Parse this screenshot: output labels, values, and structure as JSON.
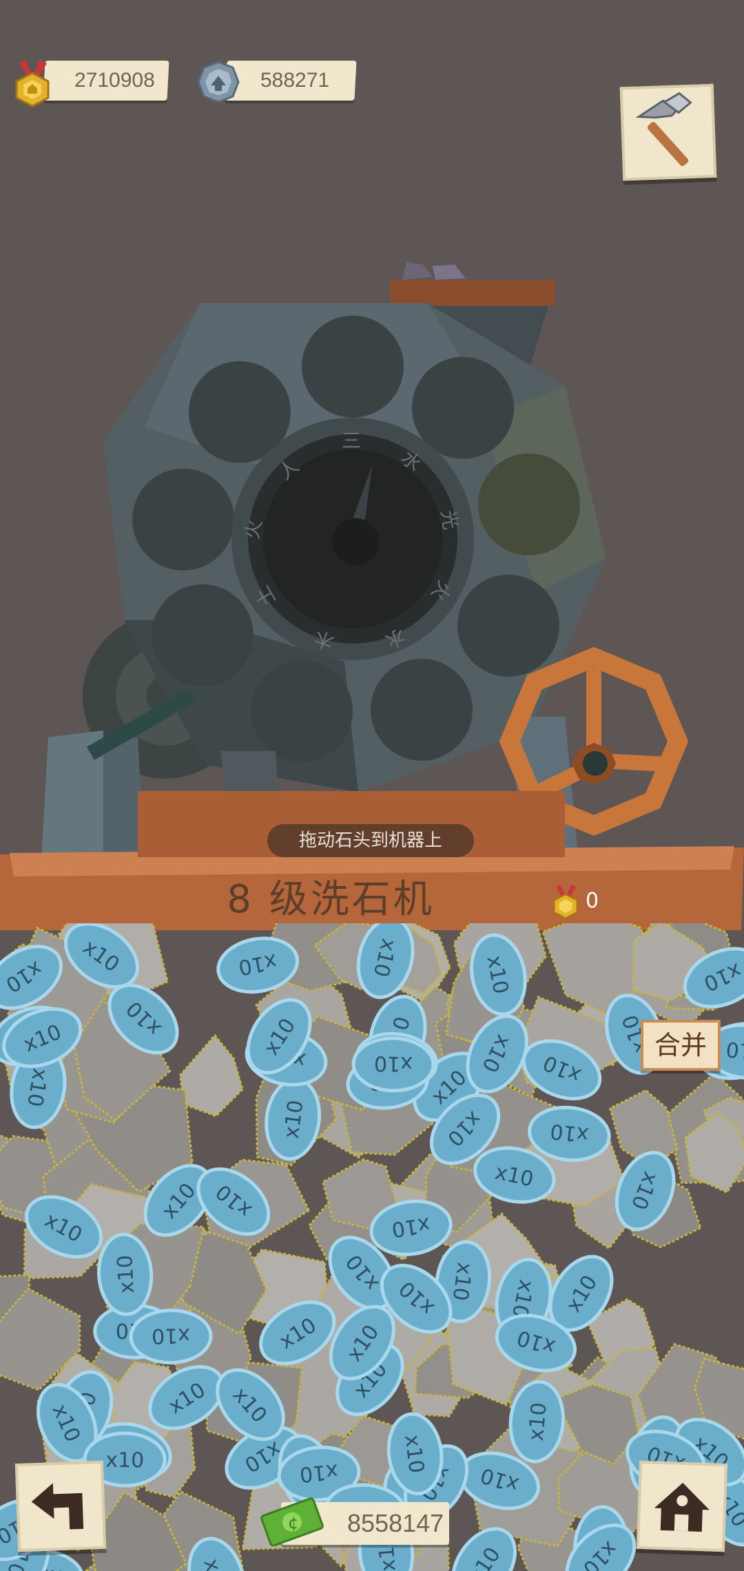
{
  "currencies": {
    "medals": "2710908",
    "stones": "588271",
    "cash": "8558147"
  },
  "machine": {
    "title": "8 级洗石机",
    "hint": "拖动石头到机器上",
    "reward_value": "0",
    "dial_symbols": [
      "三",
      "水",
      "光",
      "火",
      "水",
      "木",
      "土",
      "火",
      "人"
    ]
  },
  "pile": {
    "stone_label": "x10"
  },
  "buttons": {
    "merge_label": "合并"
  },
  "icons": {
    "medal": "medal-icon",
    "stone": "stone-coin-icon",
    "pickaxe": "pickaxe-icon",
    "back": "undo-arrow-icon",
    "home": "house-icon",
    "cash": "cash-icon"
  },
  "colors": {
    "background": "#5d5654",
    "parchment": "#f0e7cd",
    "wood": "#b5673b",
    "stone_blue": "#6aaecb",
    "machine": "#4b5559"
  }
}
